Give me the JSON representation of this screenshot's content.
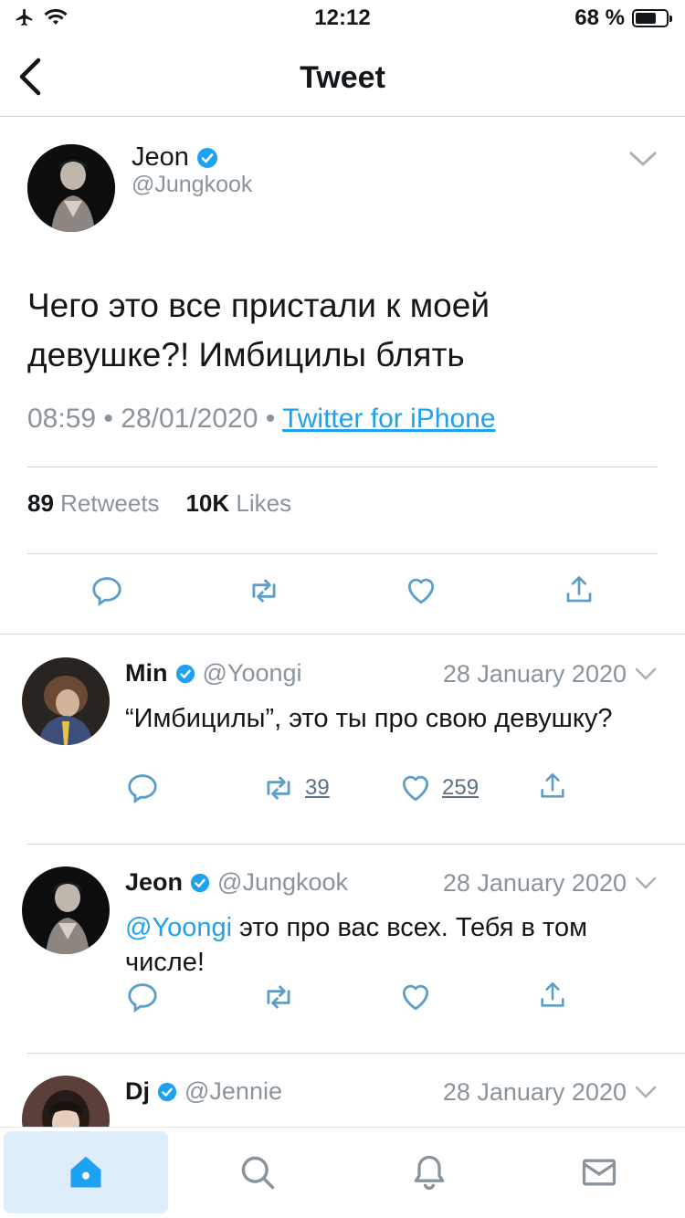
{
  "status_bar": {
    "time": "12:12",
    "battery": "68 %",
    "battery_level": 0.68
  },
  "nav": {
    "title": "Tweet"
  },
  "main_tweet": {
    "name": "Jeon",
    "handle": "@Jungkook",
    "text": "Чего это все пристали к моей девушке?! Имбицилы блять",
    "time": "08:59",
    "date": "28/01/2020",
    "source": "Twitter for iPhone",
    "retweets_count": "89",
    "retweets_label": "Retweets",
    "likes_count": "10K",
    "likes_label": "Likes"
  },
  "replies": [
    {
      "name": "Min",
      "handle": "@Yoongi",
      "date": "28 January 2020",
      "text": "“Имбицилы”, это ты про свою девушку?",
      "retweets": "39",
      "likes": "259"
    },
    {
      "name": "Jeon",
      "handle": "@Jungkook",
      "date": "28 January 2020",
      "mention": "@Yoongi",
      "text": " это про вас всех. Тебя в том числе!"
    },
    {
      "name": "Dj",
      "handle": "@Jennie",
      "date": "28 January 2020"
    }
  ],
  "colors": {
    "accent": "#1da1f2",
    "muted": "#8a949c",
    "icon": "#5b9ec9"
  }
}
